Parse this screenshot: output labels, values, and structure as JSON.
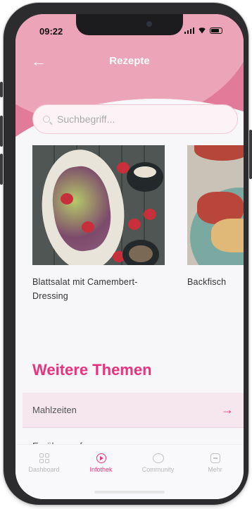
{
  "status": {
    "time": "09:22"
  },
  "header": {
    "title": "Rezepte",
    "back_icon": "arrow-left-icon"
  },
  "search": {
    "placeholder": "Suchbegriff..."
  },
  "recipes": [
    {
      "title_line1": "Blattsalat mit Camembert-",
      "title_line2": "Dressing"
    },
    {
      "title_line1": "Backfisch",
      "title_line2": ""
    }
  ],
  "section": {
    "title": "Weitere Themen"
  },
  "topics": [
    {
      "label": "Mahlzeiten"
    },
    {
      "label": "Ernährungsformen"
    }
  ],
  "tabs": [
    {
      "label": "Dashboard",
      "icon": "grid-icon"
    },
    {
      "label": "Infothek",
      "icon": "play-circle-icon"
    },
    {
      "label": "Community",
      "icon": "chat-bubble-icon"
    },
    {
      "label": "Mehr",
      "icon": "more-icon"
    }
  ],
  "colors": {
    "accent": "#e8337f",
    "header": "#e27a9a"
  }
}
